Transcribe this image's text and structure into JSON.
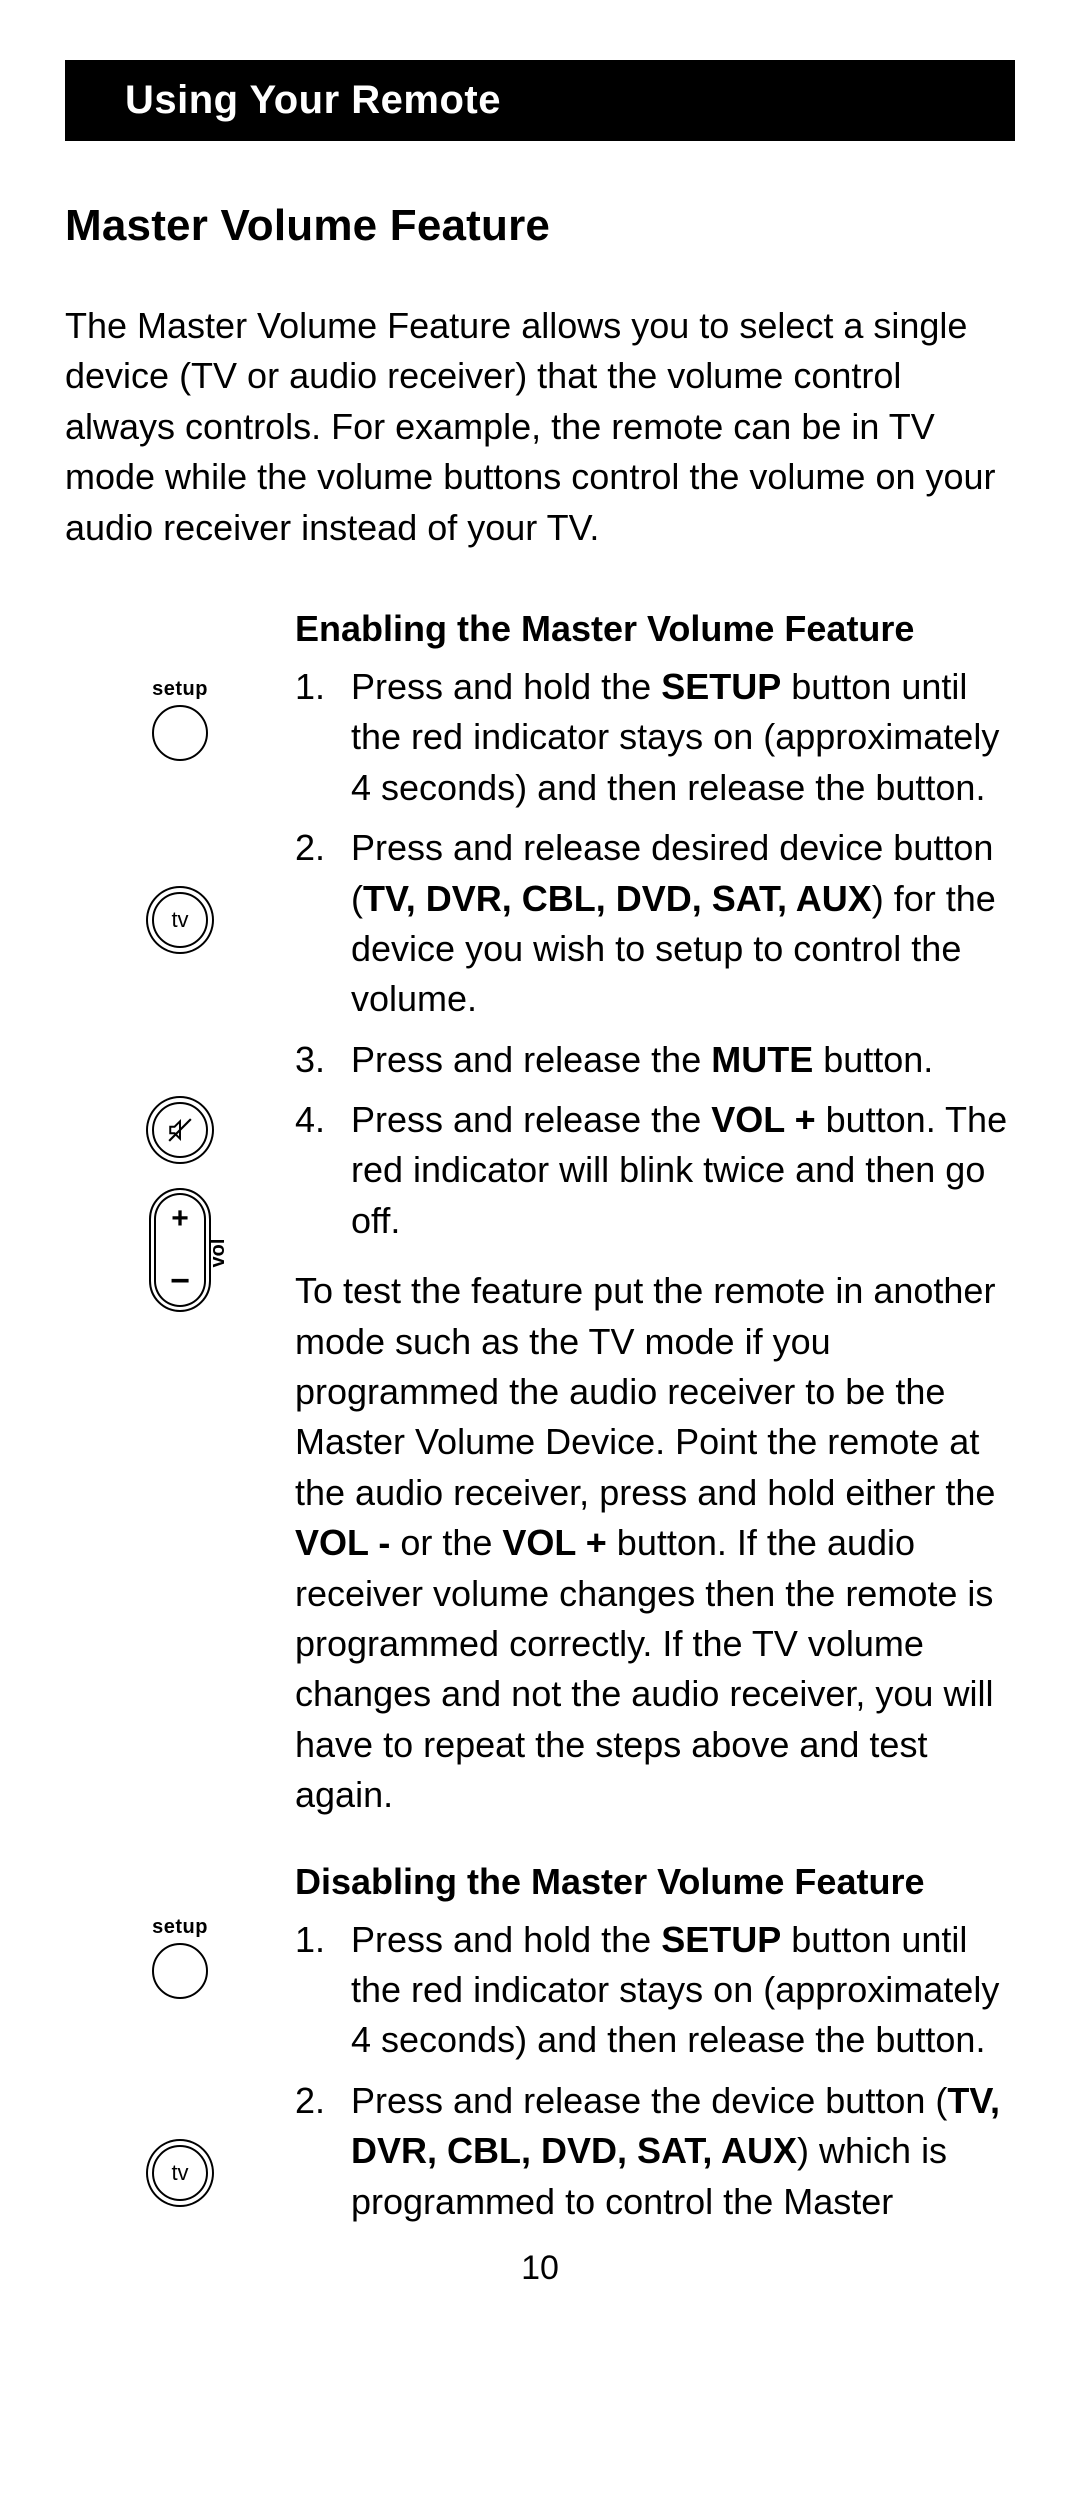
{
  "header": "Using Your Remote",
  "section_title": "Master Volume Feature",
  "intro": "The Master Volume Feature allows you to select a single device (TV or audio receiver) that the volume control always controls. For example, the remote can be in TV mode while the volume buttons control the volume on your audio receiver instead of your TV.",
  "enable": {
    "title": "Enabling the Master Volume Feature",
    "steps": [
      {
        "pre": "Press and hold the ",
        "bold1": "SETUP",
        "post1": " button until the red indicator stays on (approximately 4 seconds) and then release the button."
      },
      {
        "pre": "Press and release desired device button (",
        "bold1": "TV, DVR, CBL, DVD, SAT, AUX",
        "post1": ") for the device you wish to setup to control the volume."
      },
      {
        "pre": "Press and release the ",
        "bold1": "MUTE",
        "post1": " button."
      },
      {
        "pre": "Press and release the ",
        "bold1": "VOL +",
        "post1": " button. The red indicator will blink twice and then go off."
      }
    ],
    "test_pre": "To test the feature put the remote in another mode such as the TV mode if you programmed the audio receiver to be the Master Volume Device. Point the remote at the audio receiver, press and hold either the ",
    "test_b1": "VOL -",
    "test_mid1": " or the ",
    "test_b2": "VOL +",
    "test_post": " button. If the audio receiver volume changes then the remote is programmed correctly. If the TV volume changes and not the audio receiver, you will have to repeat the steps above and test again."
  },
  "disable": {
    "title": "Disabling the Master Volume Feature",
    "steps": [
      {
        "pre": "Press and hold the ",
        "bold1": "SETUP",
        "post1": " button until the red indicator stays on (approximately 4 seconds) and then release the button."
      },
      {
        "pre": "Press and release the device button (",
        "bold1": "TV, DVR, CBL, DVD, SAT, AUX",
        "post1": ") which is programmed to control the Master"
      }
    ]
  },
  "labels": {
    "setup": "setup",
    "tv": "tv",
    "plus": "+",
    "minus": "−",
    "vol": "vol"
  },
  "page_number": "10"
}
